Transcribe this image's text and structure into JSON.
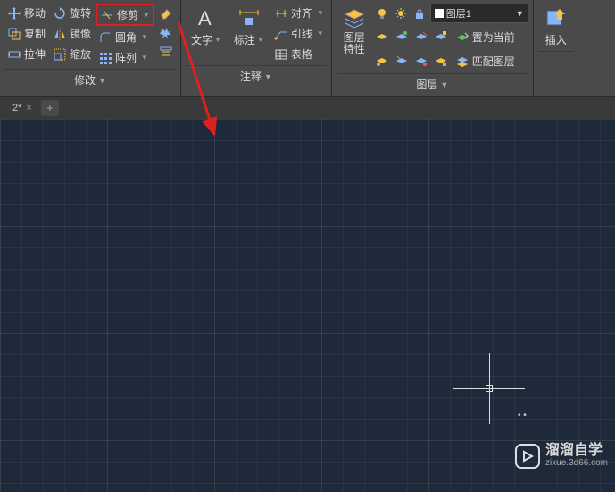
{
  "ribbon": {
    "modify": {
      "label": "修改",
      "move": "移动",
      "copy": "复制",
      "stretch": "拉伸",
      "rotate": "旋转",
      "mirror": "镜像",
      "scale": "缩放",
      "trim": "修剪",
      "fillet": "圆角",
      "array": "阵列"
    },
    "annotate": {
      "label": "注释",
      "text": "文字",
      "dim": "标注",
      "align": "对齐",
      "leader": "引线",
      "table": "表格"
    },
    "layer": {
      "label": "图层",
      "properties": "图层\n特性",
      "current_layer": "图层1",
      "set_current": "置为当前",
      "match": "匹配图层"
    },
    "insert": {
      "label": "插入"
    }
  },
  "tab": {
    "name": "2*"
  },
  "watermark": {
    "title": "溜溜自学",
    "sub": "zixue.3d66.com"
  }
}
